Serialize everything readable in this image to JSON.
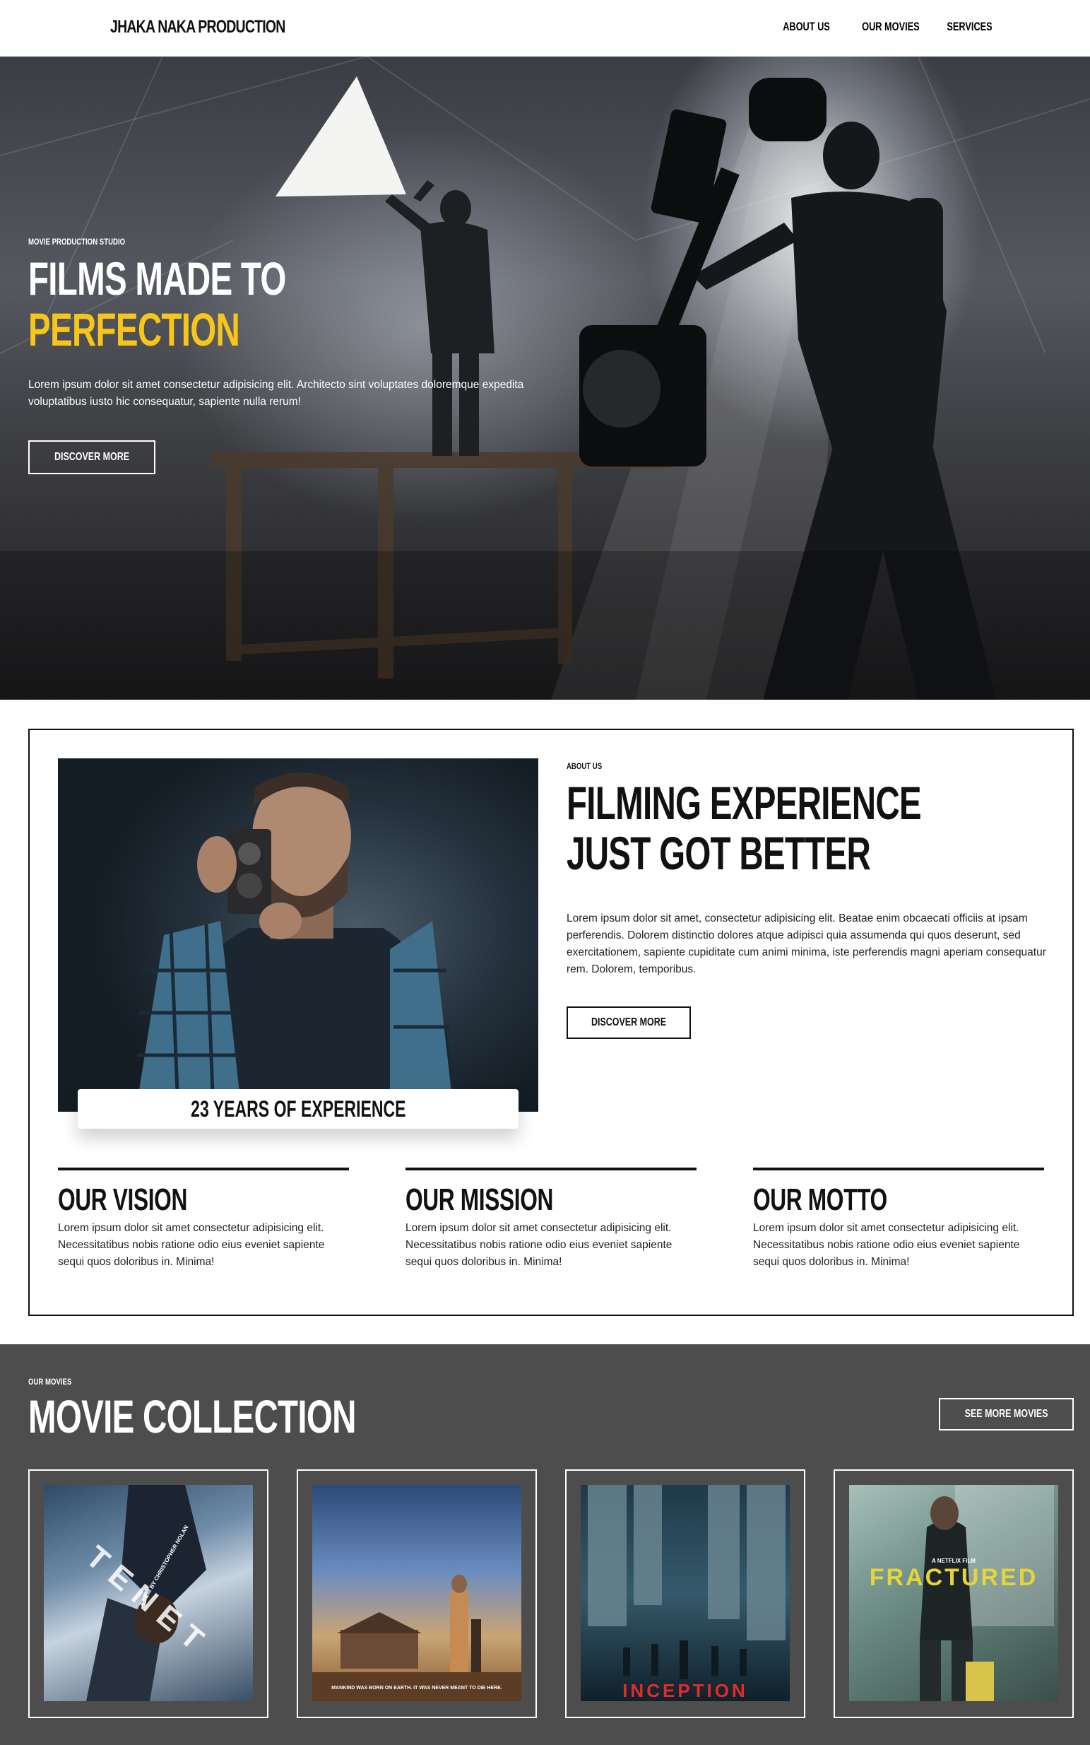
{
  "navbar": {
    "brand": "JHAKA NAKA PRODUCTION",
    "links": [
      "ABOUT US",
      "OUR MOVIES",
      "SERVICES"
    ]
  },
  "hero": {
    "eyebrow": "MOVIE PRODUCTION STUDIO",
    "title_line1": "FILMS MADE TO",
    "title_line2": "PERFECTION",
    "text": "Lorem ipsum dolor sit amet consectetur adipisicing elit. Architecto sint voluptates doloremque expedita voluptatibus iusto hic consequatur, sapiente nulla rerum!",
    "button": "DISCOVER MORE",
    "accent_color": "#f8c51b"
  },
  "about": {
    "eyebrow": "ABOUT US",
    "title_line1": "FILMING EXPERIENCE",
    "title_line2": "JUST GOT BETTER",
    "text": "Lorem ipsum dolor sit amet, consectetur adipisicing elit. Beatae enim obcaecati officiis at ipsam perferendis. Dolorem distinctio dolores atque adipisci quia assumenda qui quos deserunt, sed exercitationem, sapiente cupiditate cum animi minima, iste perferendis magni aperiam consequatur rem. Dolorem, temporibus.",
    "button": "DISCOVER MORE",
    "experience": "23 YEARS OF EXPERIENCE",
    "pillars": [
      {
        "title": "OUR VISION",
        "text": "Lorem ipsum dolor sit amet consectetur adipisicing elit. Necessitatibus nobis ratione odio eius eveniet sapiente sequi quos doloribus in. Minima!"
      },
      {
        "title": "OUR MISSION",
        "text": "Lorem ipsum dolor sit amet consectetur adipisicing elit. Necessitatibus nobis ratione odio eius eveniet sapiente sequi quos doloribus in. Minima!"
      },
      {
        "title": "OUR MOTTO",
        "text": "Lorem ipsum dolor sit amet consectetur adipisicing elit. Necessitatibus nobis ratione odio eius eveniet sapiente sequi quos doloribus in. Minima!"
      }
    ]
  },
  "movies": {
    "eyebrow": "OUR MOVIES",
    "title": "MOVIE COLLECTION",
    "button": "SEE MORE MOVIES",
    "posters": [
      {
        "title": "TENET",
        "credit": "A FILM BY CHRISTOPHER NOLAN"
      },
      {
        "title": "",
        "credit": "MANKIND WAS BORN ON EARTH. IT WAS NEVER MEANT TO DIE HERE."
      },
      {
        "title": "INCEPTION",
        "credit": ""
      },
      {
        "title": "FRACTURED",
        "credit": "A NETFLIX FILM"
      }
    ],
    "background_color": "#4d4d4d"
  }
}
